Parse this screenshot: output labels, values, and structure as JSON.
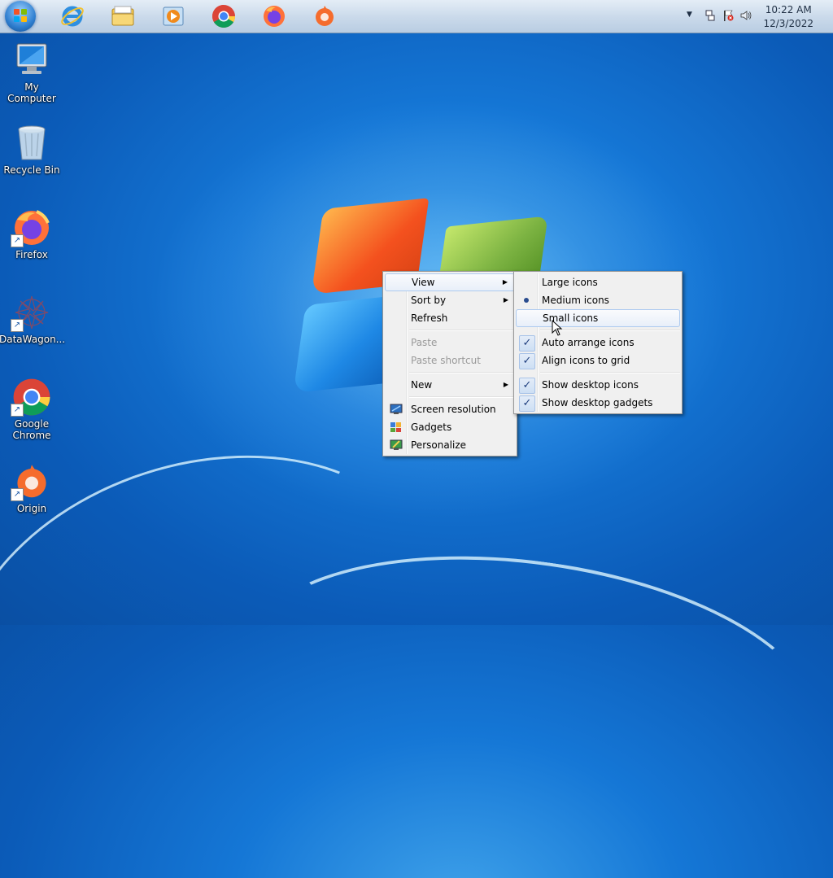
{
  "taskbar": {
    "apps": [
      {
        "name": "internet-explorer-icon"
      },
      {
        "name": "windows-explorer-icon"
      },
      {
        "name": "media-player-icon"
      },
      {
        "name": "chrome-icon"
      },
      {
        "name": "firefox-icon"
      },
      {
        "name": "origin-icon"
      }
    ],
    "clock": {
      "time": "10:22 AM",
      "date": "12/3/2022"
    }
  },
  "desktop": {
    "icons": [
      {
        "label": "My Computer"
      },
      {
        "label": "Recycle Bin"
      },
      {
        "label": "Firefox"
      },
      {
        "label": "DataWagon..."
      },
      {
        "label": "Google Chrome"
      },
      {
        "label": "Origin"
      }
    ]
  },
  "context_menu": {
    "items": {
      "view": "View",
      "sort_by": "Sort by",
      "refresh": "Refresh",
      "paste": "Paste",
      "paste_shortcut": "Paste shortcut",
      "new": "New",
      "screen_resolution": "Screen resolution",
      "gadgets": "Gadgets",
      "personalize": "Personalize"
    }
  },
  "view_submenu": {
    "large_icons": "Large icons",
    "medium_icons": "Medium icons",
    "small_icons": "Small icons",
    "auto_arrange": "Auto arrange icons",
    "align_grid": "Align icons to grid",
    "show_desktop_icons": "Show desktop icons",
    "show_desktop_gadgets": "Show desktop gadgets",
    "selected_size": "Medium icons",
    "checked": [
      "Auto arrange icons",
      "Align icons to grid",
      "Show desktop icons",
      "Show desktop gadgets"
    ]
  },
  "colors": {
    "menu_bg": "#f0f0f0",
    "hover_border": "#aecbf0",
    "desktop_blue": "#1577d6"
  }
}
